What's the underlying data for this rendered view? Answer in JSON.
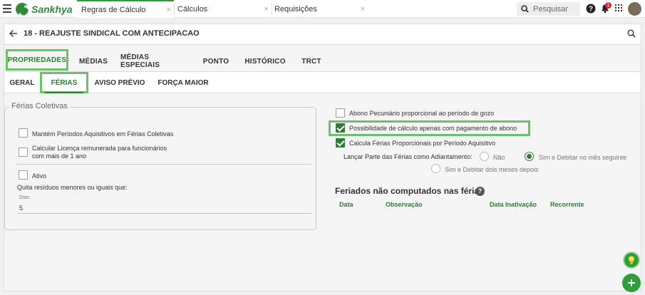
{
  "topbar": {
    "brand": "Sankhya",
    "tabs": [
      {
        "label": "Regras de Cálculo",
        "close": "×"
      },
      {
        "label": "Cálculos",
        "close": "×"
      },
      {
        "label": "Requisições",
        "close": "×"
      }
    ],
    "search_placeholder": "Pesquisar",
    "notification_count": "1"
  },
  "header": {
    "title": "18 - REAJUSTE SINDICAL COM ANTECIPACAO"
  },
  "main_tabs": [
    {
      "label": "PROPRIEDADES"
    },
    {
      "label": "MÉDIAS"
    },
    {
      "label": "MÉDIAS ESPECIAIS"
    },
    {
      "label": "PONTO"
    },
    {
      "label": "HISTÓRICO"
    },
    {
      "label": "TRCT"
    }
  ],
  "sub_tabs": [
    {
      "label": "GERAL"
    },
    {
      "label": "FÉRIAS"
    },
    {
      "label": "AVISO PRÉVIO"
    },
    {
      "label": "FORÇA MAIOR"
    }
  ],
  "ferias_coletivas": {
    "legend": "Férias Coletivas",
    "mantem_label": "Mantém Períodos Aquisitivos em Férias Coletivas",
    "calcular_label_1": "Calcular Licença remunerada para funcionários",
    "calcular_label_2": "com mais de 1 ano",
    "ativo_label": "Ativo",
    "quita_label": "Quita resíduos menores ou iguais que:",
    "dias_label": "Dias",
    "dias_value": "5"
  },
  "right": {
    "abono_label": "Abono Pecuniário proporcional ao período de gozo",
    "possibilidade_label": "Possibilidade de cálculo apenas com pagamento de abono",
    "calcula_label": "Calcula Férias Proporcionais por Período Aquisitivo",
    "lancar_label": "Lançar Parte das Férias como Adiantamento:",
    "radio_nao": "Não",
    "radio_sim_mes": "Sim e Debitar no mês seguinte",
    "radio_sim_dois": "Sim e Debitar dois meses depois"
  },
  "feriados": {
    "title": "Feriados não computados nas férias",
    "help": "?",
    "columns": [
      "Data",
      "Observação",
      "Data Inativação",
      "Recorrente"
    ]
  },
  "colors": {
    "accent": "#2e7d32",
    "highlight": "#6cc26b",
    "fab": "#2e9d3a"
  }
}
